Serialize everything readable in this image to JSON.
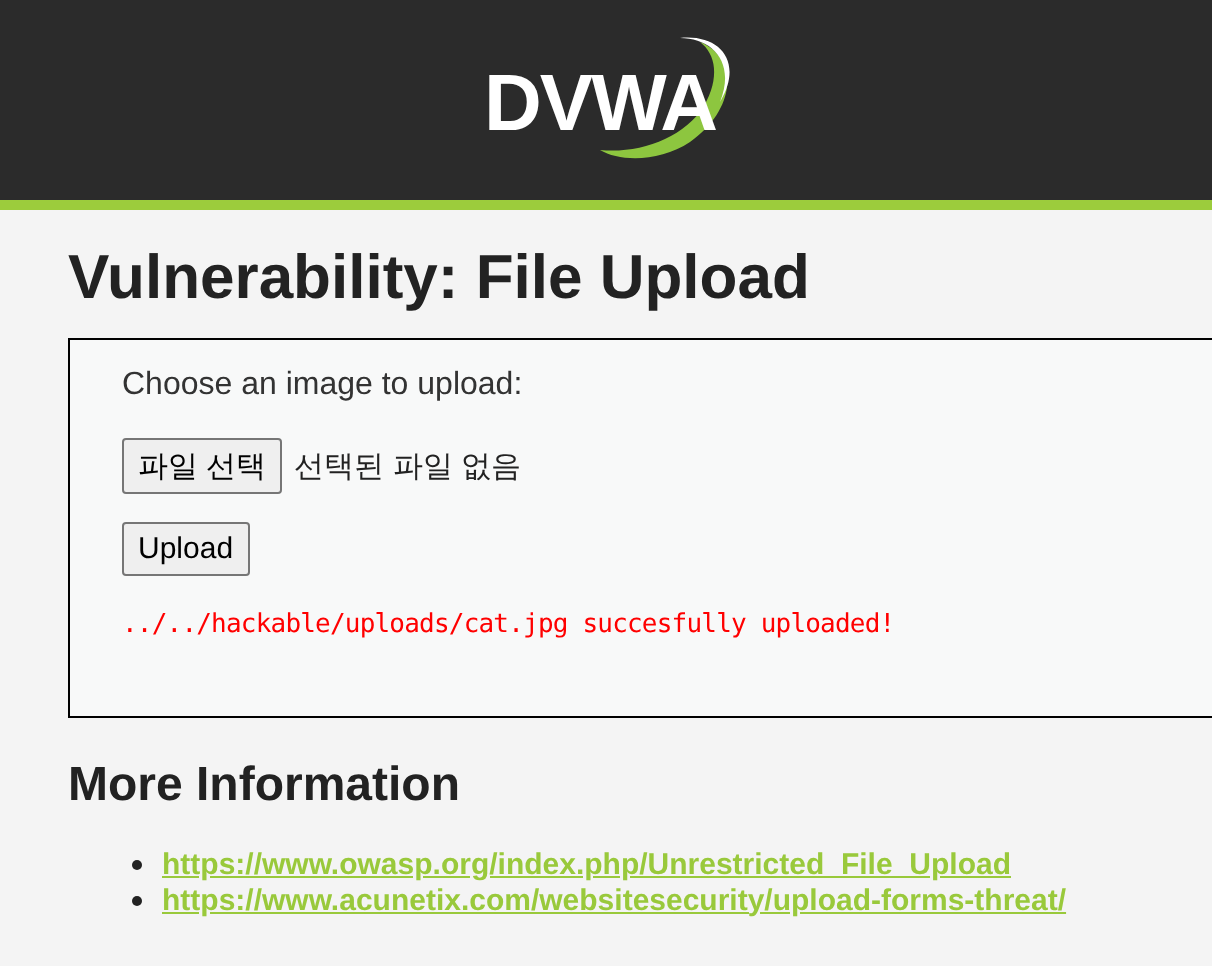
{
  "header": {
    "logo": "DVWA"
  },
  "title": "Vulnerability: File Upload",
  "form": {
    "label": "Choose an image to upload:",
    "file_button": "파일 선택",
    "file_status": "선택된 파일 없음",
    "upload_button": "Upload",
    "message": "../../hackable/uploads/cat.jpg succesfully uploaded!"
  },
  "more_info": {
    "heading": "More Information",
    "links": [
      "https://www.owasp.org/index.php/Unrestricted_File_Upload",
      "https://www.acunetix.com/websitesecurity/upload-forms-threat/"
    ]
  }
}
